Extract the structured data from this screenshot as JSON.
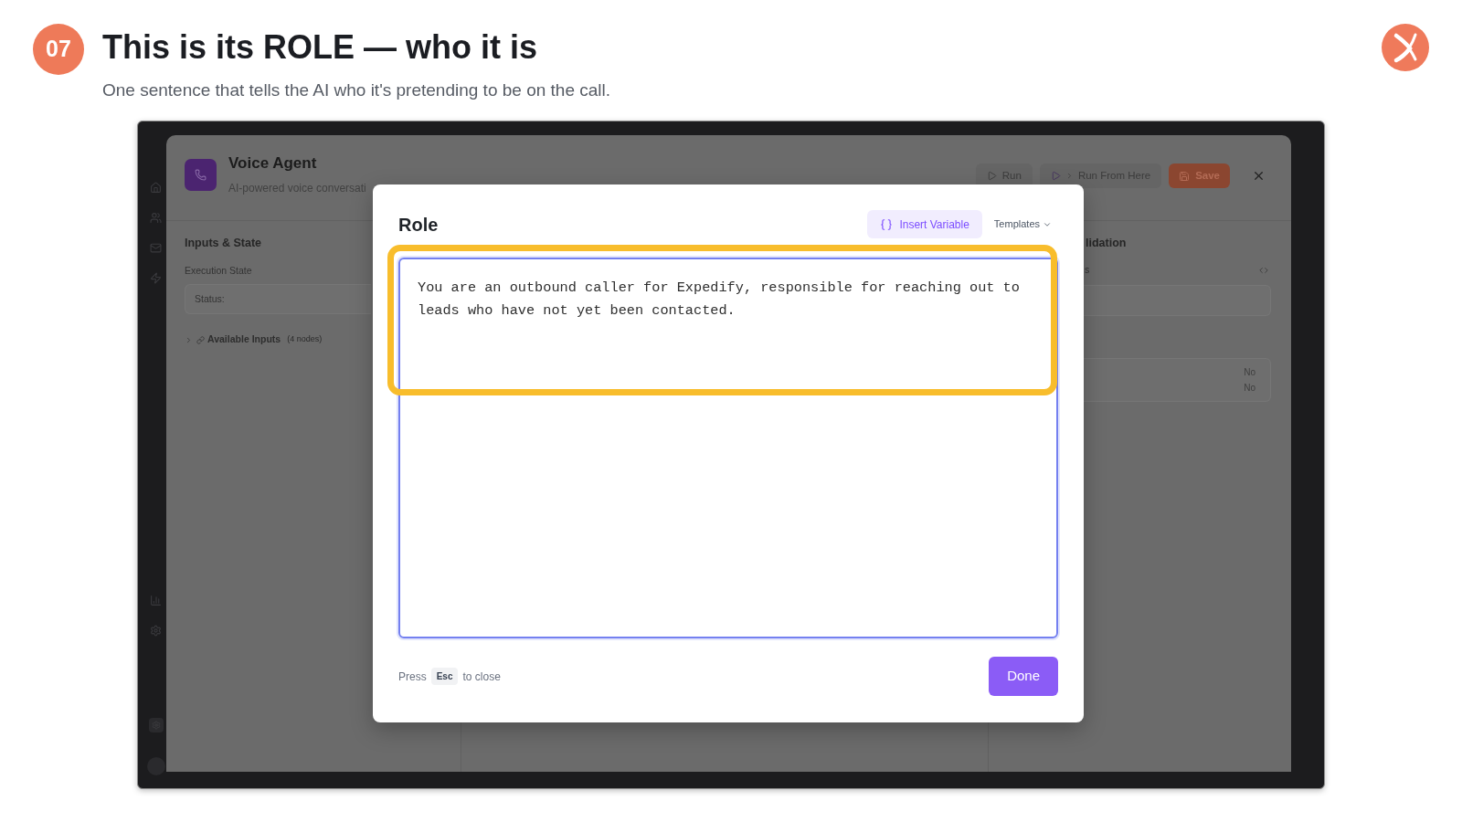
{
  "header": {
    "step": "07",
    "title": "This is its ROLE — who it is",
    "subtitle": "One sentence that tells the AI who it's pretending to be on the call."
  },
  "screenshot": {
    "app_header": {
      "title": "Voice Agent",
      "subtitle": "AI-powered voice conversati",
      "buttons": [
        {
          "kind": "run",
          "label": "Run"
        },
        {
          "kind": "run_from_here",
          "label": "Run From Here"
        },
        {
          "kind": "save",
          "label": "Save"
        }
      ]
    },
    "left_panel": {
      "heading": "Inputs & State",
      "section": "Execution State",
      "status_field": {
        "label": "Status:"
      },
      "available_inputs": {
        "label": "Available Inputs",
        "count": "(4 nodes)",
        "expanded": false
      }
    },
    "right_panel": {
      "heading": "lidation",
      "label": "s",
      "values": [
        "No",
        "No"
      ]
    },
    "modal": {
      "title": "Role",
      "insert_variable": "Insert Variable",
      "templates": "Templates",
      "text_field": {
        "value": "You are an outbound caller for Expedify, responsible for reaching out to leads who have not yet been contacted.",
        "highlighted": true
      },
      "hint": {
        "before": "Press",
        "key": "Esc",
        "after": "to close"
      },
      "done": "Done"
    }
  }
}
